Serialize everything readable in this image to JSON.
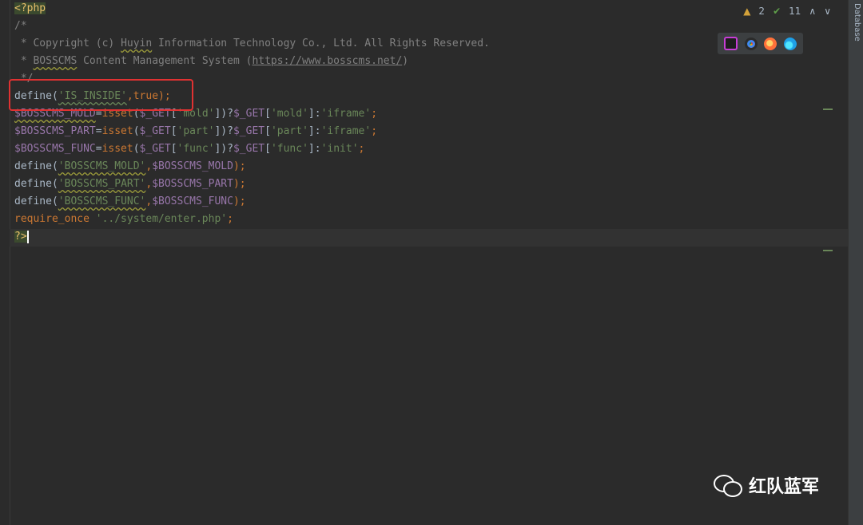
{
  "status": {
    "warnings": "2",
    "checks": "11",
    "up_arrow": "∧",
    "down_arrow": "∨"
  },
  "sidebar": {
    "database_label": "Database"
  },
  "code": {
    "l1": "<?php",
    "l2": "/*",
    "l3_a": " * Copyright (c) ",
    "l3_b": "Huyin",
    "l3_c": " Information Technology Co., Ltd. All Rights Reserved.",
    "l4_a": " * ",
    "l4_b": "BOSSCMS",
    "l4_c": " Content Management System (",
    "l4_d": "https://www.bosscms.net/",
    "l4_e": ")",
    "l5": " */",
    "l6_a": "define(",
    "l6_b": "'IS_INSIDE'",
    "l6_c": ",",
    "l6_d": "true",
    "l6_e": ");",
    "l7_a": "$BOSSCMS_MOLD",
    "l7_b": "=",
    "l7_c": "isset",
    "l7_d": "(",
    "l7_e": "$_GET",
    "l7_f": "[",
    "l7_g": "'mold'",
    "l7_h": "])?",
    "l7_i": "$_GET",
    "l7_j": "[",
    "l7_k": "'mold'",
    "l7_l": "]:",
    "l7_m": "'iframe'",
    "l7_n": ";",
    "l8_a": "$BOSSCMS_PART",
    "l8_b": "=",
    "l8_c": "isset",
    "l8_d": "(",
    "l8_e": "$_GET",
    "l8_f": "[",
    "l8_g": "'part'",
    "l8_h": "])?",
    "l8_i": "$_GET",
    "l8_j": "[",
    "l8_k": "'part'",
    "l8_l": "]:",
    "l8_m": "'iframe'",
    "l8_n": ";",
    "l9_a": "$BOSSCMS_FUNC",
    "l9_b": "=",
    "l9_c": "isset",
    "l9_d": "(",
    "l9_e": "$_GET",
    "l9_f": "[",
    "l9_g": "'func'",
    "l9_h": "])?",
    "l9_i": "$_GET",
    "l9_j": "[",
    "l9_k": "'func'",
    "l9_l": "]:",
    "l9_m": "'init'",
    "l9_n": ";",
    "l10_a": "define(",
    "l10_b": "'BOSSCMS_MOLD'",
    "l10_c": ",",
    "l10_d": "$BOSSCMS_MOLD",
    "l10_e": ");",
    "l11_a": "define(",
    "l11_b": "'BOSSCMS_PART'",
    "l11_c": ",",
    "l11_d": "$BOSSCMS_PART",
    "l11_e": ");",
    "l12_a": "define(",
    "l12_b": "'BOSSCMS_FUNC'",
    "l12_c": ",",
    "l12_d": "$BOSSCMS_FUNC",
    "l12_e": ");",
    "l13_a": "require_once",
    "l13_b": " '../system/enter.php'",
    "l13_c": ";",
    "l14": "?>"
  },
  "watermark": {
    "text": "红队蓝军"
  }
}
